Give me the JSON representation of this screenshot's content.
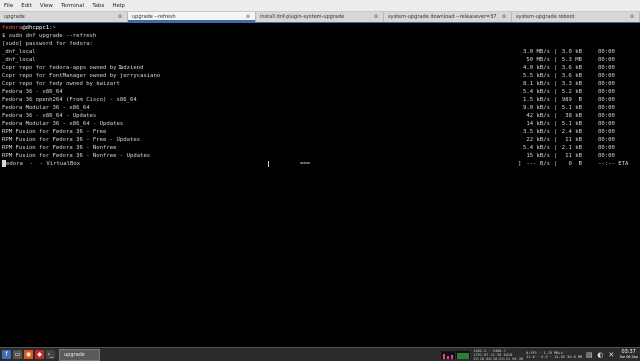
{
  "menu": [
    "File",
    "Edit",
    "View",
    "Terminal",
    "Tabs",
    "Help"
  ],
  "tabs": [
    {
      "label": "upgrade",
      "active": false
    },
    {
      "label": "upgrade --refresh",
      "active": true
    },
    {
      "label": "install dnf-plugin-system-upgrade",
      "active": false
    },
    {
      "label": "system-upgrade download --releasever=37",
      "active": false
    },
    {
      "label": "system-upgrade reboot",
      "active": false
    }
  ],
  "tab_close_glyph": "⊗",
  "terminal": {
    "prompt_user": "fedora",
    "prompt_host": "@dhcppc1",
    "prompt_path": ":~",
    "command": "$ sudo dnf upgrade --refresh",
    "sudo_prompt": "[sudo] password for fedora:",
    "repos": [
      {
        "name": "_dnf_local",
        "rate": "3.0 MB/s",
        "size": "3.0 kB",
        "eta": "00:00"
      },
      {
        "name": "_dnf_local",
        "rate": "50 MB/s",
        "size": "5.3 MB",
        "eta": "00:00"
      },
      {
        "name": "Copr repo for fedora-apps owned by adziend",
        "rate": "4.0 kB/s",
        "size": "3.6 kB",
        "eta": "00:00"
      },
      {
        "name": "Copr repo for FontManager owned by jerrycasiano",
        "rate": "5.5 kB/s",
        "size": "3.6 kB",
        "eta": "00:00"
      },
      {
        "name": "Copr repo for fedy owned by kwizart",
        "rate": "8.1 kB/s",
        "size": "3.3 kB",
        "eta": "00:00"
      },
      {
        "name": "Fedora 36 - x86_64",
        "rate": "5.4 kB/s",
        "size": "5.2 kB",
        "eta": "00:00"
      },
      {
        "name": "Fedora 36 openh264 (From Cisco) - x86_64",
        "rate": "1.5 kB/s",
        "size": "989  B",
        "eta": "00:00"
      },
      {
        "name": "Fedora Modular 36 - x86_64",
        "rate": "9.0 kB/s",
        "size": "5.1 kB",
        "eta": "00:00"
      },
      {
        "name": "Fedora 36 - x86_64 - Updates",
        "rate": "42 kB/s",
        "size": "38 kB",
        "eta": "00:00"
      },
      {
        "name": "Fedora Modular 36 - x86_64 - Updates",
        "rate": "14 kB/s",
        "size": "5.1 kB",
        "eta": "00:00"
      },
      {
        "name": "RPM Fusion for Fedora 36 - Free",
        "rate": "3.5 kB/s",
        "size": "2.4 kB",
        "eta": "00:00"
      },
      {
        "name": "RPM Fusion for Fedora 36 - Free - Updates",
        "rate": "22 kB/s",
        "size": "11 kB",
        "eta": "00:00"
      },
      {
        "name": "RPM Fusion for Fedora 36 - Nonfree",
        "rate": "5.4 kB/s",
        "size": "2.1 kB",
        "eta": "00:00"
      },
      {
        "name": "RPM Fusion for Fedora 36 - Nonfree - Updates",
        "rate": "15 kB/s",
        "size": "11 kB",
        "eta": "00:00"
      }
    ],
    "current": {
      "name": "edora  -  - VirtualBox",
      "bar": "===",
      "bracket": "]",
      "rate": "--- B/s",
      "size": "0  B",
      "eta": "--:-- ETA"
    },
    "separator": "|"
  },
  "taskbar": {
    "task_label": "upgrade",
    "stats": [
      "1462.2 · 2460.7",
      "1751.87 21.38 0410",
      "23:16 00:10:23:21 H4.38"
    ],
    "stats2": [
      "0:3P1 · 1-19 MB/s",
      "11.6 · 6.9 · 14.62 30.6 MB"
    ],
    "clock_time": "03:37",
    "clock_date": "Tue 06 Sep"
  },
  "colors": {
    "accent": "#3a6ea5",
    "prompt_user": "#ff5a5a",
    "terminal_bg": "#000000"
  }
}
